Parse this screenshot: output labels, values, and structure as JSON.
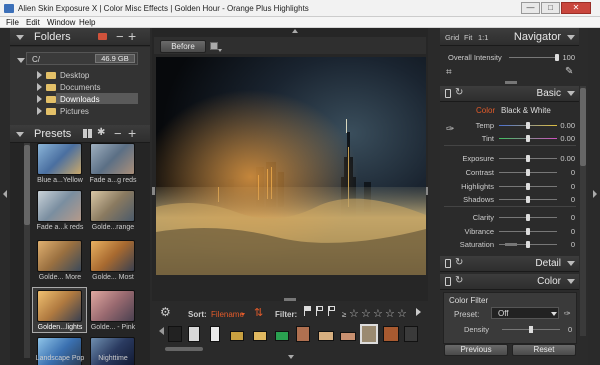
{
  "window": {
    "title": "Alien Skin Exposure X | Color Misc Effects | Golden Hour - Orange Plus Highlights",
    "minimize": "—",
    "maximize": "□",
    "close": "✕"
  },
  "menu": [
    "File",
    "Edit",
    "Window",
    "Help"
  ],
  "folders": {
    "title": "Folders",
    "drive": "C/",
    "drive_size": "46.9 GB",
    "items": [
      "Desktop",
      "Documents",
      "Downloads",
      "Pictures"
    ],
    "selected": "Downloads"
  },
  "presets": {
    "title": "Presets",
    "thumbs": [
      {
        "label": "Blue a...Yellow"
      },
      {
        "label": "Fade a...g reds"
      },
      {
        "label": "Fade a...k reds"
      },
      {
        "label": "Golde...range"
      },
      {
        "label": "Golde... More"
      },
      {
        "label": "Golde... Most"
      },
      {
        "label": "Golden...lights"
      },
      {
        "label": "Golde... - Pink"
      },
      {
        "label": "Landscape Pop"
      },
      {
        "label": "Nighttime"
      }
    ]
  },
  "viewer": {
    "before_label": "Before"
  },
  "filmstrip": {
    "sort_label": "Sort:",
    "sort_value": "Filename",
    "filter_label": "Filter:",
    "rating_prefix": "≥",
    "stars": 5
  },
  "navigator": {
    "tabs": [
      "Grid",
      "Fit",
      "1:1"
    ],
    "title": "Navigator",
    "overall_intensity_label": "Overall Intensity",
    "overall_intensity_value": "100",
    "overall_intensity_level": 1.0
  },
  "basic": {
    "title": "Basic",
    "mode_color": "Color",
    "mode_bw": "Black & White",
    "sliders": [
      {
        "label": "Temp",
        "value": "0.00",
        "level": 0.5
      },
      {
        "label": "Tint",
        "value": "0.00",
        "level": 0.5
      },
      {
        "label": "Exposure",
        "value": "0.00",
        "level": 0.5
      },
      {
        "label": "Contrast",
        "value": "0",
        "level": 0.5
      },
      {
        "label": "Highlights",
        "value": "0",
        "level": 0.5
      },
      {
        "label": "Shadows",
        "value": "0",
        "level": 0.5
      },
      {
        "label": "Clarity",
        "value": "0",
        "level": 0.5
      },
      {
        "label": "Vibrance",
        "value": "0",
        "level": 0.5
      },
      {
        "label": "Saturation",
        "value": "0",
        "level": 0.5
      }
    ]
  },
  "detail": {
    "title": "Detail"
  },
  "color": {
    "title": "Color",
    "filter_title": "Color Filter",
    "preset_label": "Preset:",
    "preset_value": "Off",
    "density_label": "Density",
    "density_value": "0",
    "density_level": 0.5
  },
  "footer": {
    "previous": "Previous",
    "reset": "Reset"
  },
  "colors": {
    "accent": "#e35b2a",
    "selected_row": "#5a5a5a"
  }
}
